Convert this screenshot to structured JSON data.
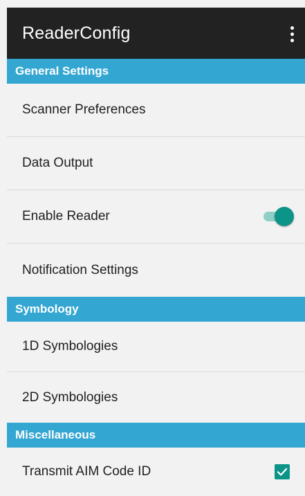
{
  "app": {
    "title": "ReaderConfig"
  },
  "sections": [
    {
      "header": "General Settings",
      "items": [
        {
          "label": "Scanner Preferences"
        },
        {
          "label": "Data Output"
        },
        {
          "label": "Enable Reader",
          "toggle_on": true
        },
        {
          "label": "Notification Settings"
        }
      ]
    },
    {
      "header": "Symbology",
      "items": [
        {
          "label": "1D Symbologies"
        },
        {
          "label": "2D Symbologies"
        }
      ]
    },
    {
      "header": "Miscellaneous",
      "items": [
        {
          "label": "Transmit AIM Code ID",
          "checked": true
        }
      ]
    }
  ],
  "colors": {
    "appbar": "#222222",
    "section_header": "#34a6d2",
    "accent": "#0d9488",
    "background": "#f2f2f2"
  },
  "icons": {
    "overflow": "more-vert-icon",
    "toggle": "switch",
    "checkbox": "check-icon"
  }
}
